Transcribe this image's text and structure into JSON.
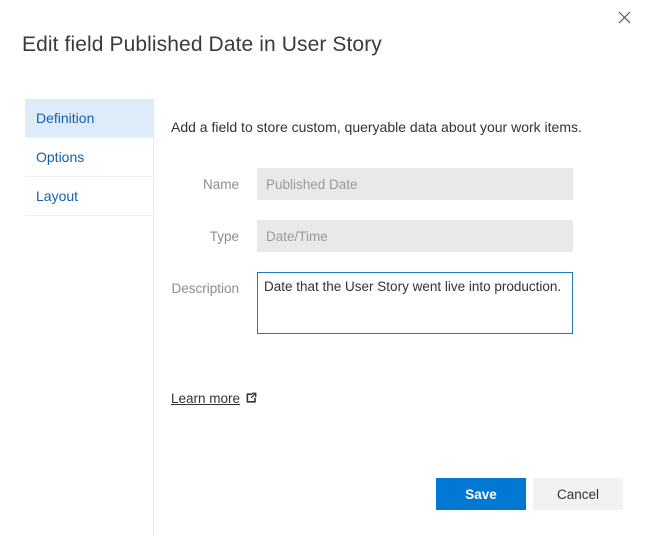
{
  "dialog": {
    "title": "Edit field Published Date in User Story",
    "close_icon": "close-icon",
    "close_label": "Close"
  },
  "sidebar": {
    "items": [
      {
        "label": "Definition",
        "selected": true
      },
      {
        "label": "Options",
        "selected": false
      },
      {
        "label": "Layout",
        "selected": false
      }
    ]
  },
  "content": {
    "intro": "Add a field to store custom, queryable data about your work items.",
    "fields": [
      {
        "label": "Name",
        "value": "Published Date",
        "placeholder": "Name",
        "disabled": true
      },
      {
        "label": "Type",
        "value": "Date/Time",
        "placeholder": "Type",
        "disabled": true
      },
      {
        "label": "Description",
        "value": "Date that the User Story went live into production.",
        "placeholder": "Description",
        "disabled": false
      }
    ],
    "learn_more": {
      "label": "Learn more",
      "icon": "external-link-icon"
    }
  },
  "footer": {
    "save_label": "Save",
    "cancel_label": "Cancel"
  },
  "colors": {
    "accent": "#0078d4",
    "selected_nav_bg": "#deecf9",
    "nav_text": "#1361ad",
    "disabled_input_bg": "#e9e9e9",
    "focus_border": "#1f78c1",
    "secondary_button_bg": "#f3f2f1"
  }
}
